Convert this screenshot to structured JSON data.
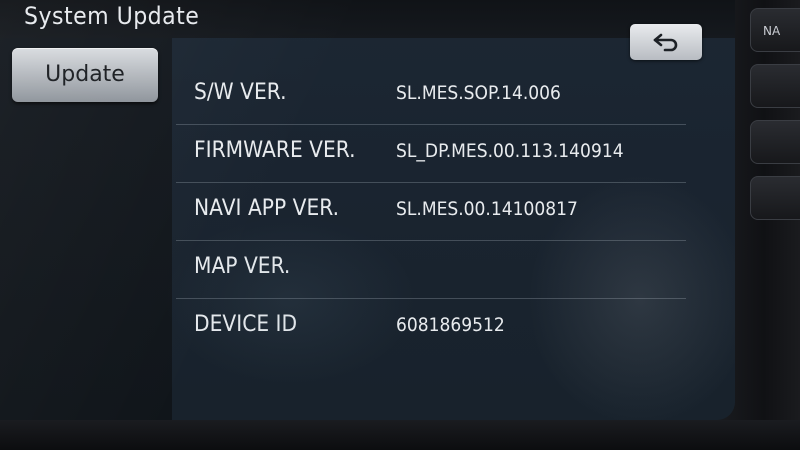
{
  "screen": {
    "title": "System Update"
  },
  "sidebar": {
    "update_label": "Update"
  },
  "info": {
    "rows": [
      {
        "label": "S/W VER.",
        "value": "SL.MES.SOP.14.006"
      },
      {
        "label": "FIRMWARE VER.",
        "value": "SL_DP.MES.00.113.140914"
      },
      {
        "label": "NAVI APP VER.",
        "value": "SL.MES.00.14100817"
      },
      {
        "label": "MAP VER.",
        "value": ""
      },
      {
        "label": "DEVICE ID",
        "value": "6081869512"
      }
    ]
  },
  "hardware_buttons": [
    {
      "label": "NA"
    },
    {
      "label": ""
    },
    {
      "label": ""
    },
    {
      "label": ""
    }
  ],
  "icons": {
    "back": "back-arrow-icon"
  },
  "colors": {
    "screen_background": "#1a2430",
    "text": "#e8ebee",
    "button_light": "#d9dce0"
  }
}
